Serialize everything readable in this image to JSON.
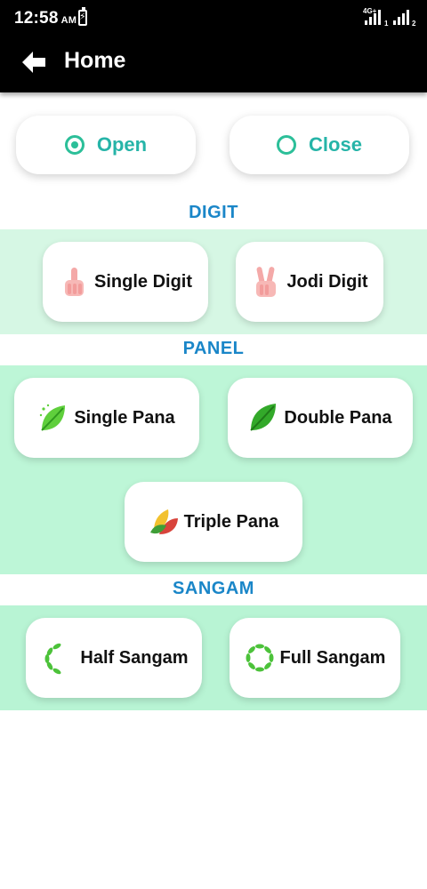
{
  "status_bar": {
    "time": "12:58",
    "ampm": "AM",
    "network_label": "4G+",
    "sim1": "1",
    "sim2": "2"
  },
  "app_bar": {
    "title": "Home",
    "back_icon": "arrow-left-icon"
  },
  "session_toggle": {
    "open_label": "Open",
    "close_label": "Close",
    "selected": "Open",
    "accent_color": "#2cbf99"
  },
  "sections": {
    "digit": {
      "title": "DIGIT",
      "items": [
        {
          "label": "Single Digit",
          "icon": "one-finger-hand-icon"
        },
        {
          "label": "Jodi Digit",
          "icon": "victory-hand-icon"
        }
      ]
    },
    "panel": {
      "title": "PANEL",
      "items": [
        {
          "label": "Single Pana",
          "icon": "single-leaf-icon"
        },
        {
          "label": "Double Pana",
          "icon": "green-leaf-icon"
        },
        {
          "label": "Triple Pana",
          "icon": "three-leaves-icon"
        }
      ]
    },
    "sangam": {
      "title": "SANGAM",
      "items": [
        {
          "label": "Half Sangam",
          "icon": "half-leaf-wreath-icon"
        },
        {
          "label": "Full Sangam",
          "icon": "full-leaf-wreath-icon"
        }
      ]
    }
  },
  "colors": {
    "section_title": "#1a86c8",
    "digit_band": "#d6f7e4",
    "panel_band": "#bdf6d7",
    "sangam_band": "#b8f4d4"
  }
}
